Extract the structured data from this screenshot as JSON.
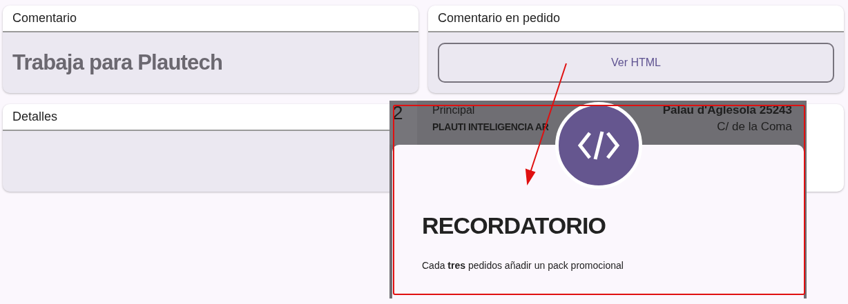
{
  "cards": [
    {
      "title": "Comentario",
      "kind": "text",
      "value": "Trabaja para Plautech"
    },
    {
      "title": "Comentario en pedido",
      "kind": "button",
      "value": "Ver HTML"
    },
    {
      "title": "Detalles",
      "kind": "empty"
    }
  ],
  "overlay": {
    "background_row": {
      "column_1": "2",
      "column_2": [
        "Principal",
        "PLAUTI INTELIGENCIA AR"
      ],
      "column_3": [
        "Palau d'Aglesola 25243",
        "C/ de la Coma"
      ]
    },
    "dialog": {
      "title": "RECORDATORIO",
      "message": "Cada **tres** pedidos añadir un pack promocional"
    }
  }
}
